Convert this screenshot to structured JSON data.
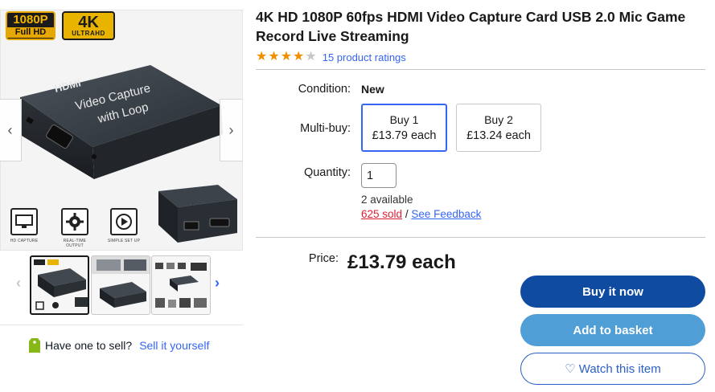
{
  "gallery": {
    "badges": {
      "b1_top": "1080P",
      "b1_bottom": "Full HD",
      "b2_top": "4K",
      "b2_bottom": "ULTRAHD"
    },
    "device_text": {
      "brand": "HDMI",
      "line1": "Video Capture",
      "line2": "with Loop"
    },
    "features": [
      {
        "icon": "monitor-icon",
        "caption": "HD CAPTURE"
      },
      {
        "icon": "gear-icon",
        "caption": "REAL-TIME OUTPUT"
      },
      {
        "icon": "play-icon",
        "caption": "SIMPLE SET UP"
      }
    ],
    "arrow_prev": "‹",
    "arrow_next": "›",
    "thumb_prev": "‹",
    "thumb_next": "›"
  },
  "sell": {
    "question": "Have one to sell?",
    "link": "Sell it yourself"
  },
  "product": {
    "title": "4K HD 1080P 60fps HDMI Video Capture Card USB 2.0 Mic Game Record Live Streaming",
    "rating": {
      "stars": 4,
      "out_of": 5,
      "count_text": "15 product ratings"
    },
    "condition_label": "Condition:",
    "condition_value": "New",
    "multibuy_label": "Multi-buy:",
    "multibuy_options": [
      {
        "line1": "Buy 1",
        "line2": "£13.79 each",
        "selected": true
      },
      {
        "line1": "Buy 2",
        "line2": "£13.24 each",
        "selected": false
      }
    ],
    "quantity_label": "Quantity:",
    "quantity_value": "1",
    "available": "2 available",
    "sold": "625 sold",
    "separator": "/",
    "feedback": "See Feedback",
    "price_label": "Price:",
    "price_value": "£13.79 each"
  },
  "actions": {
    "buy_now": "Buy it now",
    "add_to_basket": "Add to basket",
    "watch": "Watch this item"
  },
  "colors": {
    "link": "#3665f3",
    "buy_button": "#0f4ca1",
    "basket_button": "#4f9ed6",
    "star": "#f18e00",
    "sold": "#dd1e31"
  }
}
